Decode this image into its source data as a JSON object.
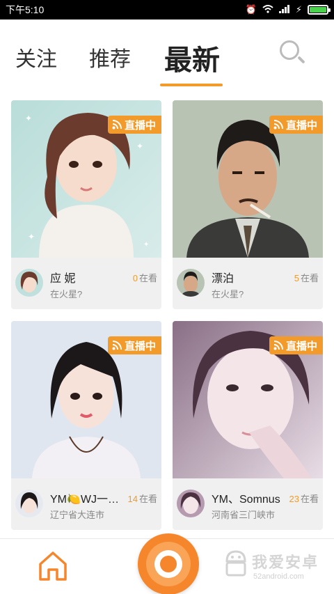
{
  "status_bar": {
    "time": "下午5:10"
  },
  "tabs": [
    {
      "label": "关注"
    },
    {
      "label": "推荐"
    },
    {
      "label": "最新"
    }
  ],
  "accent_color": "#f39b2a",
  "cards": [
    {
      "badge": "直播中",
      "name": "应 妮",
      "viewers": "0",
      "watch_label": "在看",
      "location": "在火星?"
    },
    {
      "badge": "直播中",
      "name": "漂泊",
      "viewers": "5",
      "watch_label": "在看",
      "location": "在火星?"
    },
    {
      "badge": "直播中",
      "name": "YM🍋WJ一只...",
      "viewers": "14",
      "watch_label": "在看",
      "location": "辽宁省大连市"
    },
    {
      "badge": "直播中",
      "name": "YM、Somnus",
      "viewers": "23",
      "watch_label": "在看",
      "location": "河南省三门峡市"
    }
  ],
  "watermark": {
    "text": "我爱安卓",
    "url": "52android.com"
  }
}
